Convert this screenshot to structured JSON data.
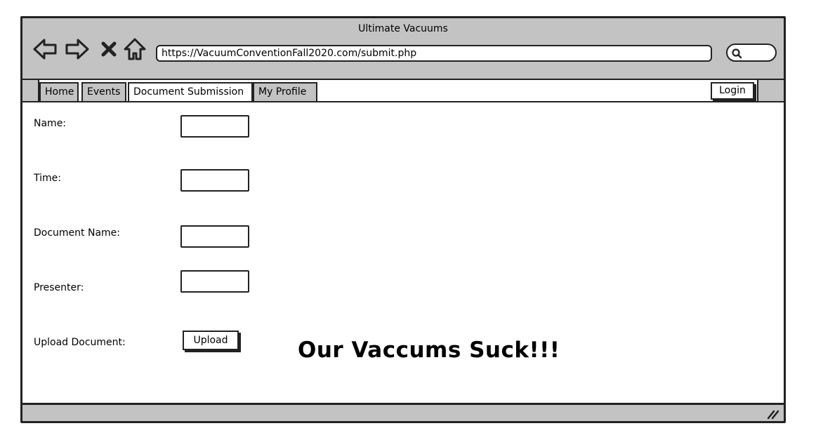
{
  "window": {
    "title": "Ultimate Vacuums"
  },
  "browser": {
    "url": "https://VacuumConventionFall2020.com/submit.php",
    "nav_icons": [
      "back-arrow-icon",
      "forward-arrow-icon",
      "close-icon",
      "home-icon"
    ],
    "search_icon": "search-icon"
  },
  "tabs": [
    {
      "label": "Home"
    },
    {
      "label": "Events"
    },
    {
      "label": "Document Submission",
      "active": true
    },
    {
      "label": "My Profile"
    }
  ],
  "header": {
    "login_label": "Login"
  },
  "form": {
    "name_label": "Name:",
    "time_label": "Time:",
    "document_name_label": "Document Name:",
    "presenter_label": "Presenter:",
    "upload_label": "Upload Document:",
    "upload_button": "Upload"
  },
  "slogan": "Our Vaccums Suck!!!",
  "colors": {
    "chrome": "#c3c3c3",
    "border": "#222222",
    "background": "#ffffff"
  }
}
